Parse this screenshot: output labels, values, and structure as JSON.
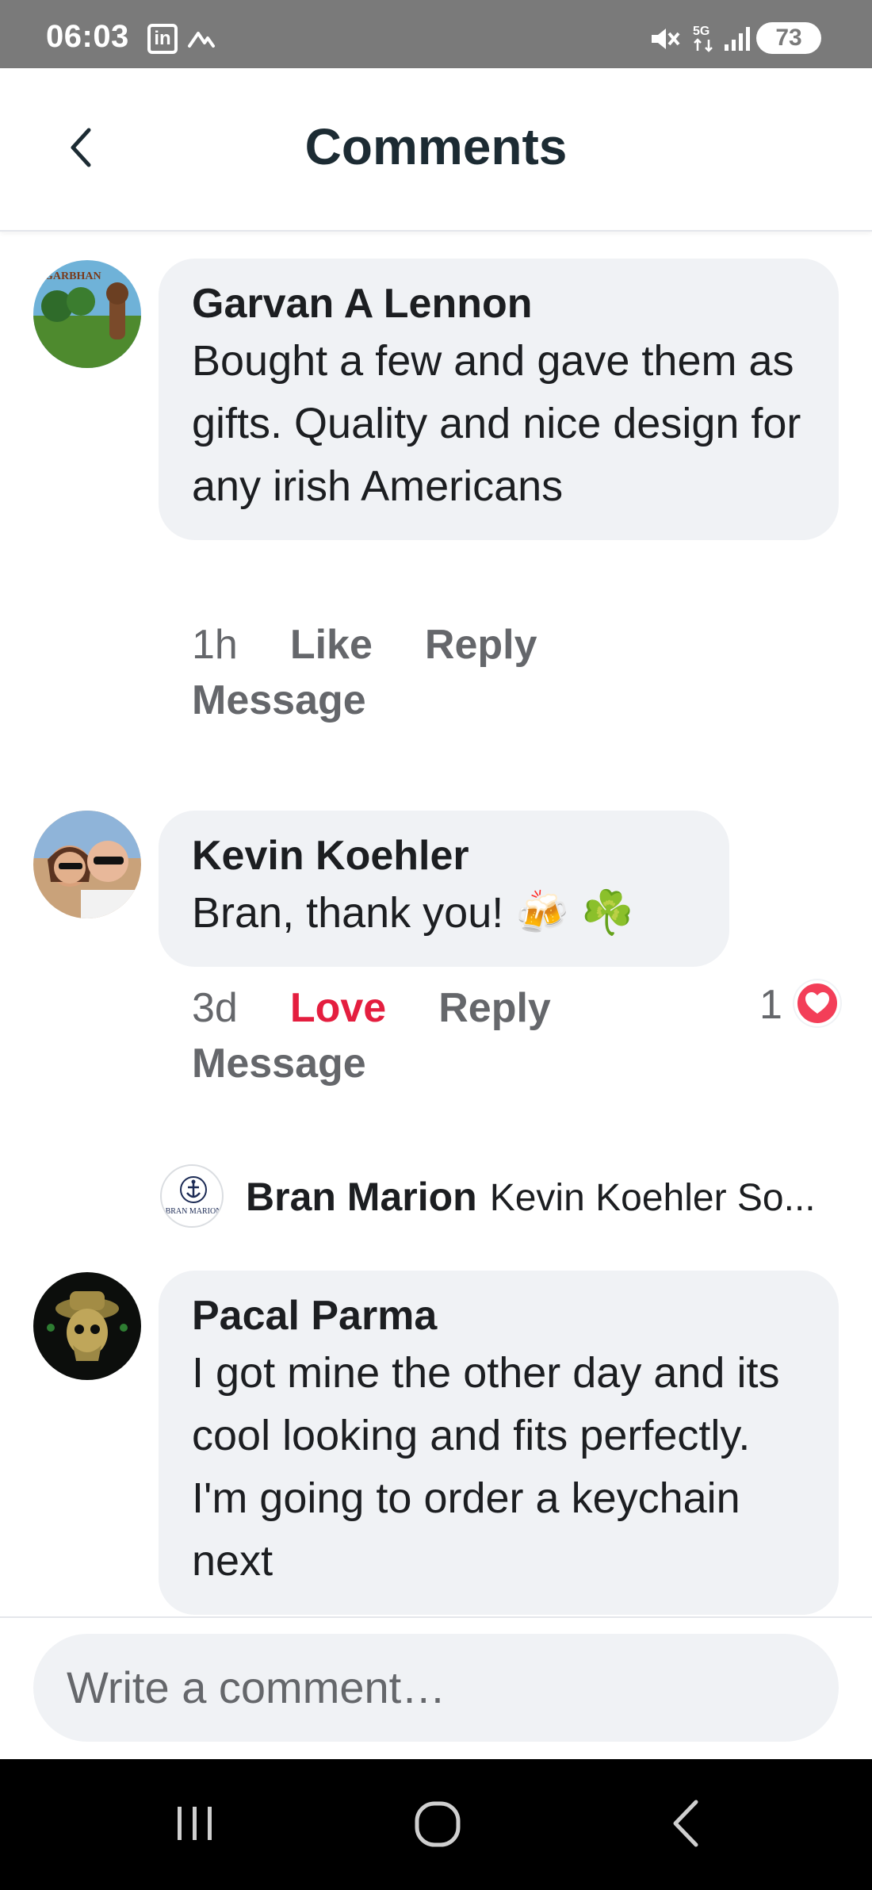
{
  "status_bar": {
    "time": "06:03",
    "linkedin_icon": "linkedin-icon",
    "battery": "73"
  },
  "header": {
    "title": "Comments",
    "back_icon": "back-chevron-icon"
  },
  "comments": [
    {
      "author": "Garvan A Lennon",
      "text": "Bought a few and gave them as gifts. Quality and nice design for any irish Americans",
      "time": "1h",
      "like": "Like",
      "reply": "Reply",
      "message": "Message"
    },
    {
      "author": "Kevin Koehler",
      "text": "Bran, thank you! 🍻 ☘️",
      "time": "3d",
      "like": "Love",
      "reply": "Reply",
      "message": "Message",
      "reaction_count": "1"
    },
    {
      "author": "Pacal Parma",
      "text": "I got mine the other day and its cool looking and fits perfectly. I'm going to order a keychain next"
    }
  ],
  "reply_preview": {
    "avatar_text": "BRAN MARION",
    "author": "Bran Marion",
    "text": "Kevin Koehler So..."
  },
  "composer": {
    "placeholder": "Write a comment…"
  },
  "colors": {
    "bubble": "#f0f2f5",
    "love": "#e41e3f",
    "meta": "#65676b"
  }
}
